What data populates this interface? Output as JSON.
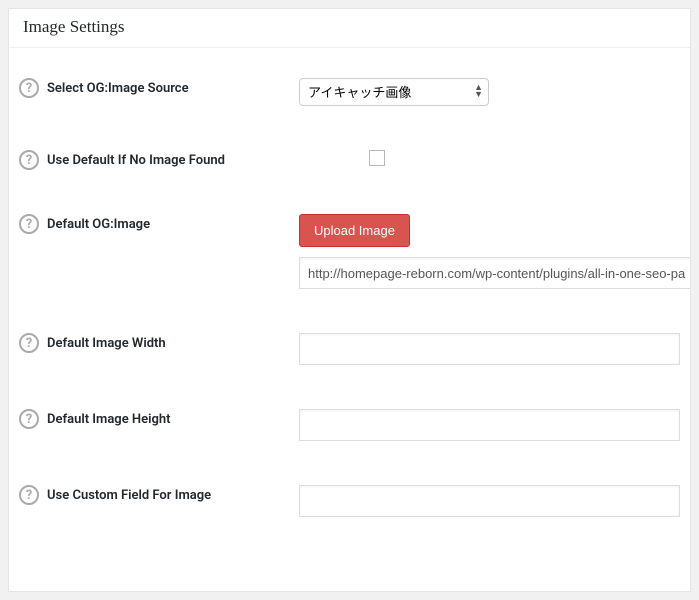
{
  "section": {
    "title": "Image Settings"
  },
  "fields": {
    "source": {
      "label": "Select OG:Image Source",
      "selected": "アイキャッチ画像"
    },
    "defaultIfNone": {
      "label": "Use Default If No Image Found"
    },
    "defaultImage": {
      "label": "Default OG:Image",
      "uploadButton": "Upload Image",
      "value": "http://homepage-reborn.com/wp-content/plugins/all-in-one-seo-pa"
    },
    "width": {
      "label": "Default Image Width",
      "value": ""
    },
    "height": {
      "label": "Default Image Height",
      "value": ""
    },
    "customField": {
      "label": "Use Custom Field For Image",
      "value": ""
    }
  },
  "help": {
    "glyph": "?"
  }
}
